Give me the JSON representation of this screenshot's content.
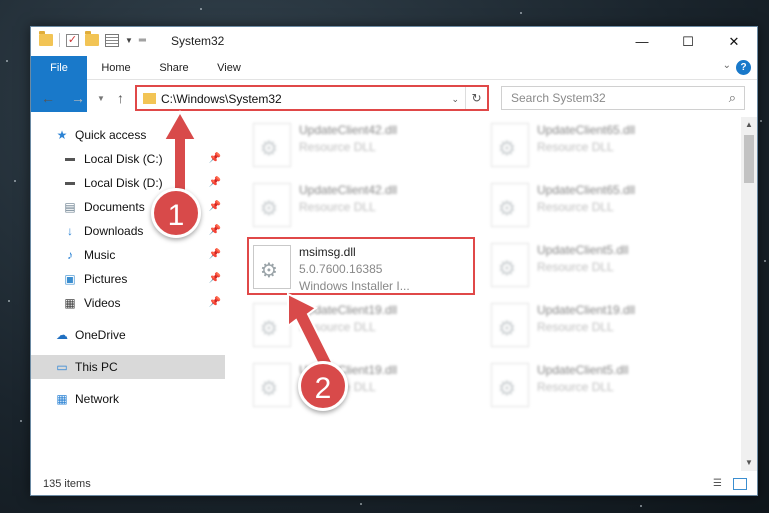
{
  "window": {
    "title": "System32",
    "minimize_glyph": "—",
    "maximize_glyph": "☐",
    "close_glyph": "✕"
  },
  "ribbon": {
    "tabs": [
      "File",
      "Home",
      "Share",
      "View"
    ],
    "help_glyph": "?",
    "expand_glyph": "⌄"
  },
  "address": {
    "path": "C:\\Windows\\System32",
    "search_placeholder": "Search System32"
  },
  "navigation": {
    "items": [
      {
        "label": "Quick access",
        "icon": "star-icon",
        "pinned": false
      },
      {
        "label": "Local Disk (C:)",
        "icon": "drive-icon",
        "pinned": true
      },
      {
        "label": "Local Disk (D:)",
        "icon": "drive-icon",
        "pinned": true
      },
      {
        "label": "Documents",
        "icon": "documents-icon",
        "pinned": true
      },
      {
        "label": "Downloads",
        "icon": "download-icon",
        "pinned": true
      },
      {
        "label": "Music",
        "icon": "music-icon",
        "pinned": true
      },
      {
        "label": "Pictures",
        "icon": "pictures-icon",
        "pinned": true
      },
      {
        "label": "Videos",
        "icon": "videos-icon",
        "pinned": true
      },
      {
        "label": "OneDrive",
        "icon": "cloud-icon",
        "pinned": false
      },
      {
        "label": "This PC",
        "icon": "computer-icon",
        "pinned": false,
        "selected": true
      },
      {
        "label": "Network",
        "icon": "network-icon",
        "pinned": false
      }
    ]
  },
  "files": [
    {
      "name": "UpdateClient42.dll",
      "line2": "Resource DLL",
      "line3": "",
      "blurred": true
    },
    {
      "name": "UpdateClient65.dll",
      "line2": "Resource DLL",
      "line3": "",
      "blurred": true
    },
    {
      "name": "UpdateClient42.dll",
      "line2": "Resource DLL",
      "line3": "",
      "blurred": true
    },
    {
      "name": "UpdateClient65.dll",
      "line2": "Resource DLL",
      "line3": "",
      "blurred": true
    },
    {
      "name": "msimsg.dll",
      "line2": "5.0.7600.16385",
      "line3": "Windows Installer I...",
      "blurred": false,
      "highlighted": true
    },
    {
      "name": "UpdateClient5.dll",
      "line2": "Resource DLL",
      "line3": "",
      "blurred": true
    },
    {
      "name": "UpdateClient19.dll",
      "line2": "Resource DLL",
      "line3": "",
      "blurred": true
    },
    {
      "name": "UpdateClient19.dll",
      "line2": "Resource DLL",
      "line3": "",
      "blurred": true
    },
    {
      "name": "UpdateClient19.dll",
      "line2": "Resource DLL",
      "line3": "",
      "blurred": true
    },
    {
      "name": "UpdateClient5.dll",
      "line2": "Resource DLL",
      "line3": "",
      "blurred": true
    }
  ],
  "status": {
    "item_count": "135 items"
  },
  "callouts": {
    "step1": "1",
    "step2": "2",
    "color": "#d84a4a"
  }
}
